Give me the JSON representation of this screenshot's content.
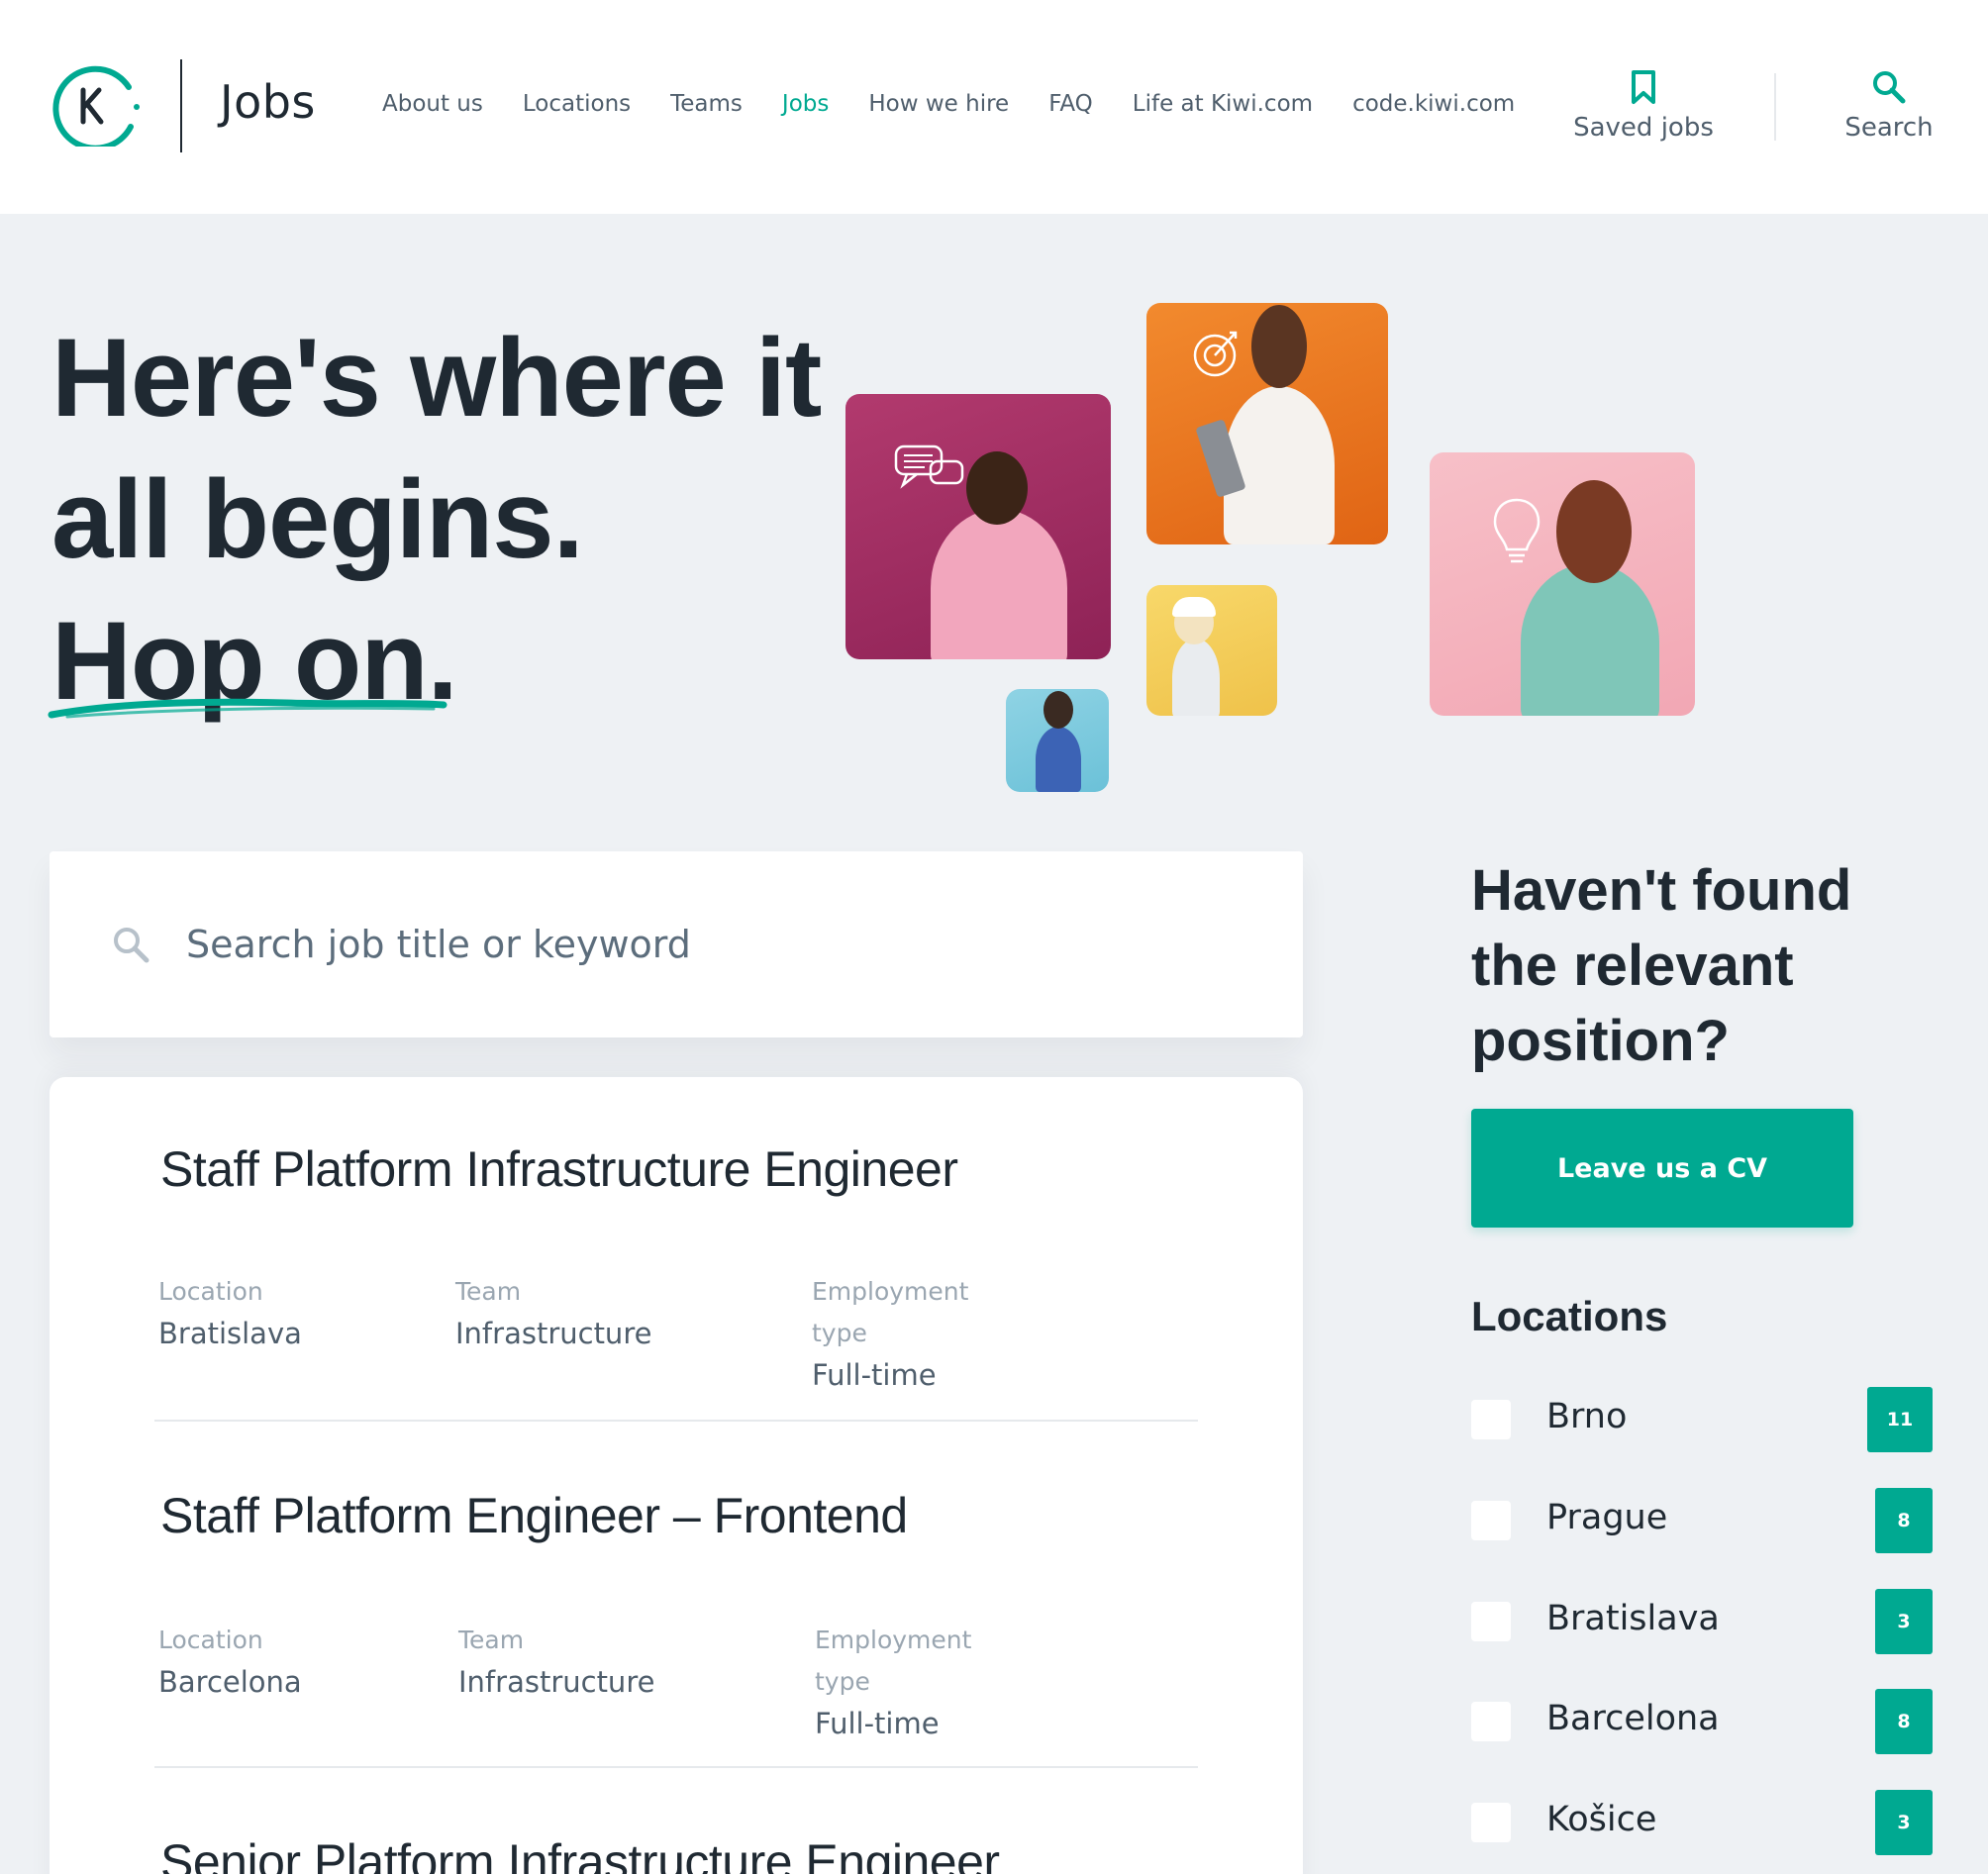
{
  "header": {
    "brand": "Jobs",
    "nav": [
      {
        "label": "About us",
        "active": false
      },
      {
        "label": "Locations",
        "active": false
      },
      {
        "label": "Teams",
        "active": false
      },
      {
        "label": "Jobs",
        "active": true
      },
      {
        "label": "How we hire",
        "active": false
      },
      {
        "label": "FAQ",
        "active": false
      },
      {
        "label": "Life at Kiwi.com",
        "active": false
      },
      {
        "label": "code.kiwi.com",
        "active": false
      }
    ],
    "saved_jobs_label": "Saved jobs",
    "search_label": "Search"
  },
  "hero": {
    "line1": "Here's where it",
    "line2": "all begins.",
    "line3": "Hop on."
  },
  "search": {
    "placeholder": "Search job title or keyword"
  },
  "jobs": [
    {
      "title": "Staff Platform Infrastructure Engineer",
      "location_label": "Location",
      "location": "Bratislava",
      "team_label": "Team",
      "team": "Infrastructure",
      "type_label_1": "Employment",
      "type_label_2": "type",
      "type": "Full-time"
    },
    {
      "title": "Staff Platform Engineer – Frontend",
      "location_label": "Location",
      "location": "Barcelona",
      "team_label": "Team",
      "team": "Infrastructure",
      "type_label_1": "Employment",
      "type_label_2": "type",
      "type": "Full-time"
    },
    {
      "title": "Senior Platform Infrastructure Engineer"
    }
  ],
  "sidebar": {
    "title_line1": "Haven't found",
    "title_line2": "the relevant",
    "title_line3": "position?",
    "cv_button": "Leave us a CV",
    "locations_heading": "Locations",
    "locations": [
      {
        "name": "Brno",
        "count": "11"
      },
      {
        "name": "Prague",
        "count": "8"
      },
      {
        "name": "Bratislava",
        "count": "3"
      },
      {
        "name": "Barcelona",
        "count": "8"
      },
      {
        "name": "Košice",
        "count": "3"
      }
    ]
  },
  "colors": {
    "accent": "#00a991",
    "text": "#1f2932",
    "muted": "#4f5e6c",
    "background": "#eef1f4"
  },
  "icons": {
    "logo": "kiwi-logo-icon",
    "saved": "bookmark-icon",
    "search": "search-icon"
  }
}
